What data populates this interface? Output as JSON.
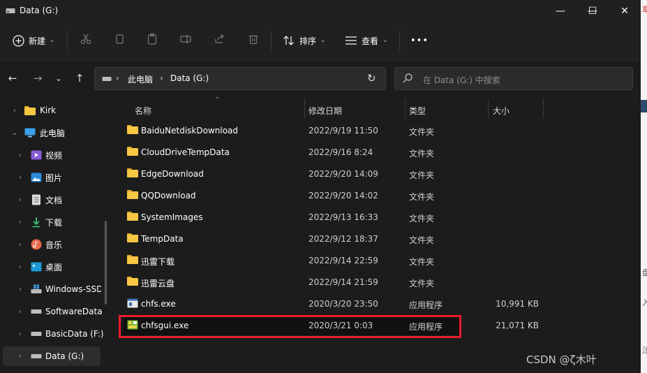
{
  "window": {
    "title": "Data (G:)",
    "controls": {
      "minimize": "—",
      "maximize": "☐",
      "close": "✕"
    }
  },
  "toolbar": {
    "new_label": "新建",
    "sort_label": "排序",
    "view_label": "查看",
    "more_label": "•••"
  },
  "address": {
    "crumbs": [
      "此电脑",
      "Data (G:)"
    ],
    "search_placeholder": "在 Data (G:) 中搜索"
  },
  "sidebar": {
    "items": [
      {
        "label": "Kirk",
        "icon": "folder-icon",
        "expander": "›"
      },
      {
        "label": "此电脑",
        "icon": "computer-icon",
        "expander": "⌄"
      },
      {
        "label": "视频",
        "icon": "video-icon",
        "expander": "›"
      },
      {
        "label": "图片",
        "icon": "pictures-icon",
        "expander": "›"
      },
      {
        "label": "文档",
        "icon": "documents-icon",
        "expander": "›"
      },
      {
        "label": "下载",
        "icon": "download-icon",
        "expander": "›"
      },
      {
        "label": "音乐",
        "icon": "music-icon",
        "expander": "›"
      },
      {
        "label": "桌面",
        "icon": "desktop-icon",
        "expander": "›"
      },
      {
        "label": "Windows-SSD",
        "icon": "windows-drive-icon",
        "expander": "›"
      },
      {
        "label": "SoftwareData",
        "icon": "drive-icon",
        "expander": "›"
      },
      {
        "label": "BasicData (F:)",
        "icon": "drive-icon",
        "expander": "›"
      },
      {
        "label": "Data (G:)",
        "icon": "drive-icon",
        "expander": "›"
      }
    ]
  },
  "columns": {
    "name": "名称",
    "date": "修改日期",
    "type": "类型",
    "size": "大小"
  },
  "files": [
    {
      "name": "BaiduNetdiskDownload",
      "date": "2022/9/19 11:50",
      "type": "文件夹",
      "size": "",
      "icon": "folder-icon"
    },
    {
      "name": "CloudDriveTempData",
      "date": "2022/9/16 8:24",
      "type": "文件夹",
      "size": "",
      "icon": "folder-icon"
    },
    {
      "name": "EdgeDownload",
      "date": "2022/9/20 14:09",
      "type": "文件夹",
      "size": "",
      "icon": "folder-icon"
    },
    {
      "name": "QQDownload",
      "date": "2022/9/20 14:02",
      "type": "文件夹",
      "size": "",
      "icon": "folder-icon"
    },
    {
      "name": "SystemImages",
      "date": "2022/9/13 16:33",
      "type": "文件夹",
      "size": "",
      "icon": "folder-icon"
    },
    {
      "name": "TempData",
      "date": "2022/9/12 18:37",
      "type": "文件夹",
      "size": "",
      "icon": "folder-icon"
    },
    {
      "name": "迅雷下载",
      "date": "2022/9/14 22:59",
      "type": "文件夹",
      "size": "",
      "icon": "folder-icon"
    },
    {
      "name": "迅雷云盘",
      "date": "2022/9/14 21:59",
      "type": "文件夹",
      "size": "",
      "icon": "folder-icon"
    },
    {
      "name": "chfs.exe",
      "date": "2020/3/20 23:50",
      "type": "应用程序",
      "size": "10,991 KB",
      "icon": "app-icon"
    },
    {
      "name": "chfsgui.exe",
      "date": "2020/3/21 0:03",
      "type": "应用程序",
      "size": "21,071 KB",
      "icon": "gui-app-icon"
    }
  ],
  "watermark": "CSDN @ζ木叶 ",
  "colors": {
    "highlight": "#e81d2a",
    "folder": "#f7c744",
    "background": "#1c1c1c"
  }
}
